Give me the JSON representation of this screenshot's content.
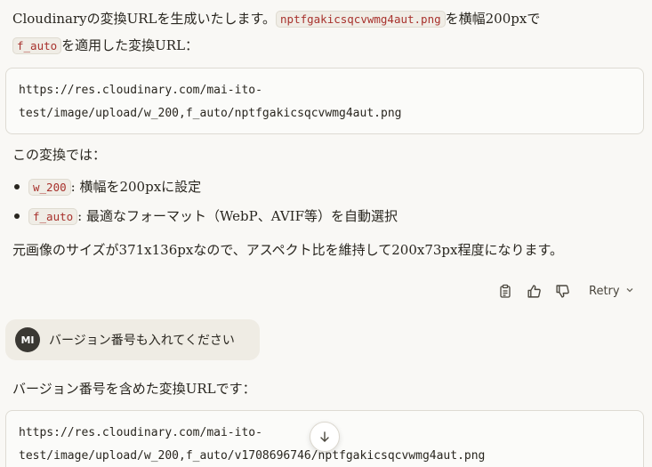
{
  "assistant_message_1": {
    "intro_line1_prefix": "Cloudinaryの変換URLを生成いたします。",
    "intro_filename": "nptfgakicsqcvwmg4aut.png",
    "intro_line1_suffix": "を横幅200pxで",
    "intro_line2_code": "f_auto",
    "intro_line2_suffix": "を適用した変換URL：",
    "code_line1": "https://res.cloudinary.com/mai-ito-",
    "code_line2": "test/image/upload/w_200,f_auto/nptfgakicsqcvwmg4aut.png",
    "transform_heading": "この変換では：",
    "bullets": [
      {
        "code": "w_200",
        "text": ": 横幅を200pxに設定"
      },
      {
        "code": "f_auto",
        "text": ": 最適なフォーマット（WebP、AVIF等）を自動選択"
      }
    ],
    "summary": "元画像のサイズが371x136pxなので、アスペクト比を維持して200x73px程度になります。"
  },
  "actions": {
    "copy_icon": "clipboard-icon",
    "thumbs_up_icon": "thumbs-up-icon",
    "thumbs_down_icon": "thumbs-down-icon",
    "retry_label": "Retry"
  },
  "user_message": {
    "avatar_initials": "MI",
    "text": "バージョン番号も入れてください"
  },
  "assistant_message_2": {
    "intro": "バージョン番号を含めた変換URLです：",
    "code_line1": "https://res.cloudinary.com/mai-ito-",
    "code_line2": "test/image/upload/w_200,f_auto/v1708696746/nptfgakicsqcvwmg4aut.png"
  },
  "scroll_button": {
    "icon": "arrow-down-icon"
  },
  "colors": {
    "background": "#f9f8f5",
    "inline_code_text": "#a8322d",
    "user_bubble": "#efece4",
    "avatar_bg": "#3a3833"
  }
}
